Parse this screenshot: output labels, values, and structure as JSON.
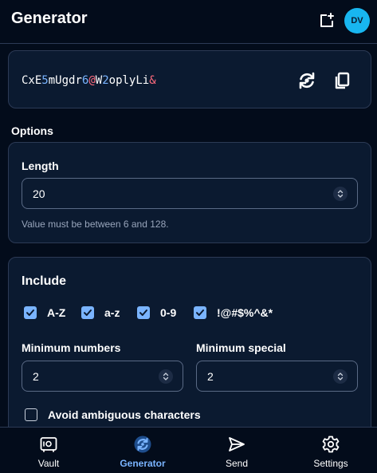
{
  "header": {
    "title": "Generator",
    "avatar_initials": "DV"
  },
  "password": {
    "segments": [
      {
        "text": "CxE",
        "kind": "ch"
      },
      {
        "text": "5",
        "kind": "num"
      },
      {
        "text": "mUgdr",
        "kind": "ch"
      },
      {
        "text": "6",
        "kind": "num"
      },
      {
        "text": "@",
        "kind": "sp"
      },
      {
        "text": "W",
        "kind": "ch"
      },
      {
        "text": "2",
        "kind": "num"
      },
      {
        "text": "oplyLi",
        "kind": "ch"
      },
      {
        "text": "&",
        "kind": "sp"
      }
    ]
  },
  "options": {
    "section_label": "Options",
    "length_label": "Length",
    "length_value": "20",
    "length_hint": "Value must be between 6 and 128."
  },
  "include": {
    "title": "Include",
    "upper_label": "A-Z",
    "lower_label": "a-z",
    "digits_label": "0-9",
    "special_label": "!@#$%^&*",
    "min_numbers_label": "Minimum numbers",
    "min_numbers_value": "2",
    "min_special_label": "Minimum special",
    "min_special_value": "2",
    "ambiguous_label": "Avoid ambiguous characters"
  },
  "nav": {
    "vault": "Vault",
    "generator": "Generator",
    "send": "Send",
    "settings": "Settings"
  },
  "colors": {
    "accent": "#7ab4ff",
    "special_char": "#ff6b7d",
    "avatar": "#18b6f0"
  }
}
